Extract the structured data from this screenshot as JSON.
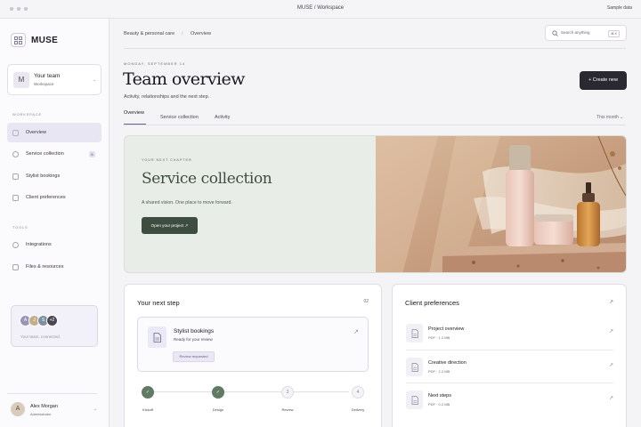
{
  "window": {
    "title": "MUSE / Workspace",
    "sample_label": "Sample data"
  },
  "sidebar": {
    "brand": "MUSE",
    "team": {
      "avatar": "M",
      "name": "Your team",
      "role": "Workspace"
    },
    "workspace_label": "WORKSPACE",
    "items": [
      {
        "label": "Overview",
        "icon": "home-icon",
        "active": true
      },
      {
        "label": "Service collection",
        "icon": "users-icon",
        "badge": "6"
      },
      {
        "label": "Stylist bookings",
        "icon": "calendar-icon"
      },
      {
        "label": "Client preferences",
        "icon": "document-icon"
      }
    ],
    "tools_label": "TOOLS",
    "tools": [
      {
        "label": "Integrations",
        "icon": "integrations-icon"
      },
      {
        "label": "Files & resources",
        "icon": "file-icon"
      }
    ],
    "connect": {
      "avatars": [
        "A",
        "J",
        "S"
      ],
      "more": "+2",
      "text": "Your team, connected."
    },
    "user": {
      "avatar": "A",
      "name": "Alex Morgan",
      "role": "Administrator"
    }
  },
  "header": {
    "breadcrumb": [
      "Beauty & personal care",
      "Overview"
    ],
    "search_placeholder": "Search anything",
    "search_shortcut": "⌘ K"
  },
  "page": {
    "date": "MONDAY, SEPTEMBER 14",
    "title": "Team overview",
    "subtitle": "Activity, relationships and the next step.",
    "create_label": "+ Create new"
  },
  "tabs": [
    "Overview",
    "Service collection",
    "Activity"
  ],
  "range_label": "This month",
  "hero": {
    "kicker": "YOUR NEXT CHAPTER",
    "title": "Service collection",
    "subtitle": "A shared vision. One place to move forward.",
    "button": "Open your project ↗"
  },
  "next_step": {
    "title": "Your next step",
    "count": "02",
    "item": {
      "name": "Stylist bookings",
      "status": "Ready for your review",
      "badge": "Review requested"
    },
    "steps": [
      {
        "label": "Kickoff",
        "state": "done",
        "mark": "✓"
      },
      {
        "label": "Design",
        "state": "done",
        "mark": "✓"
      },
      {
        "label": "Review",
        "state": "todo",
        "mark": "3"
      },
      {
        "label": "Delivery",
        "state": "todo",
        "mark": "4"
      }
    ]
  },
  "client_preferences": {
    "title": "Client preferences",
    "files": [
      {
        "name": "Project overview",
        "meta": "PDF · 1.2 MB"
      },
      {
        "name": "Creative direction",
        "meta": "PDF · 2.2 MB"
      },
      {
        "name": "Next steps",
        "meta": "PDF · 0.2 MB"
      }
    ]
  },
  "colors": {
    "accent": "#6b6189",
    "hero_bg": "#e8ede8",
    "hero_button": "#3d4e40",
    "dark_button": "#2a2830"
  }
}
